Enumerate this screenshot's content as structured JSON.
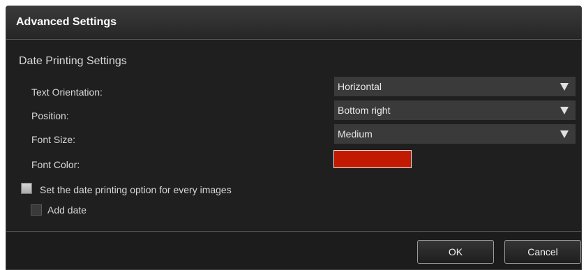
{
  "dialog": {
    "title": "Advanced Settings"
  },
  "section": {
    "title": "Date Printing Settings"
  },
  "settings": {
    "text_orientation": {
      "label": "Text Orientation:",
      "value": "Horizontal"
    },
    "position": {
      "label": "Position:",
      "value": "Bottom right"
    },
    "font_size": {
      "label": "Font Size:",
      "value": "Medium"
    },
    "font_color": {
      "label": "Font Color:",
      "color": "#c21a00"
    }
  },
  "options": {
    "every_images": {
      "label": "Set the date printing option for every images",
      "checked": false
    },
    "add_date": {
      "label": "Add date",
      "checked": false,
      "enabled": false
    }
  },
  "buttons": {
    "ok": "OK",
    "cancel": "Cancel"
  },
  "icons": {
    "dropdown": "triangle-down-icon"
  }
}
